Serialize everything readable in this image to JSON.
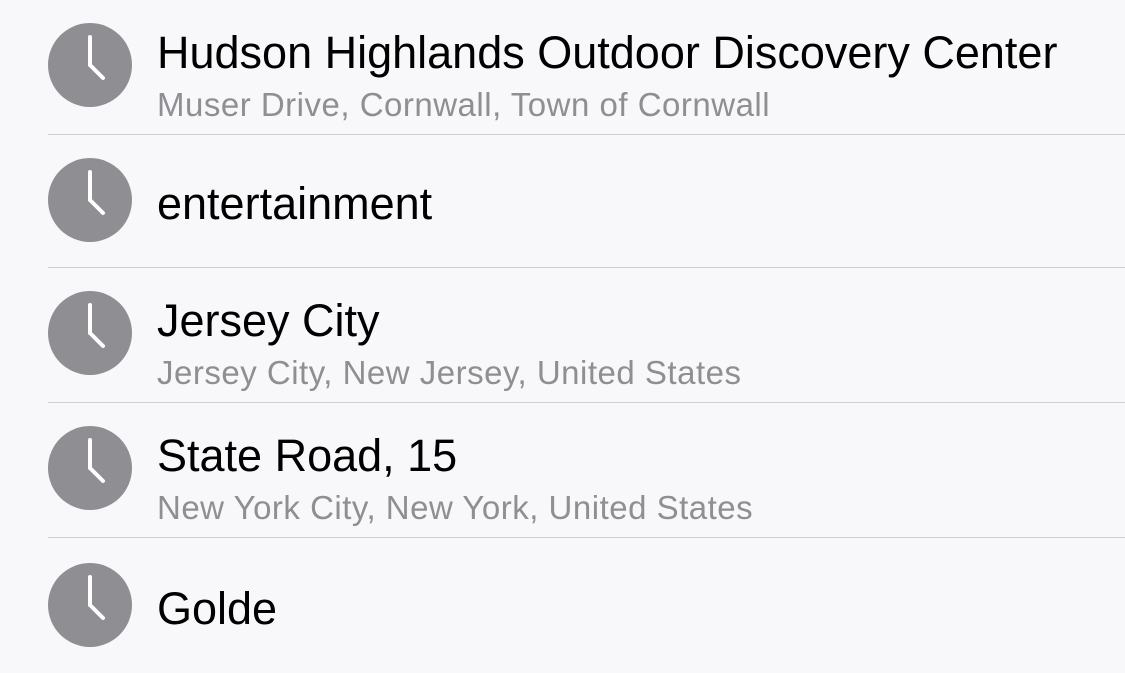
{
  "recents": {
    "items": [
      {
        "title": "Hudson Highlands Outdoor Discovery Center",
        "subtitle": "Muser Drive, Cornwall, Town of Cornwall",
        "icon": "clock-icon"
      },
      {
        "title": "entertainment",
        "subtitle": "",
        "icon": "clock-icon"
      },
      {
        "title": "Jersey City",
        "subtitle": "Jersey City, New Jersey, United States",
        "icon": "clock-icon"
      },
      {
        "title": "State Road, 15",
        "subtitle": "New York City, New York, United States",
        "icon": "clock-icon"
      },
      {
        "title": "Golde",
        "subtitle": "",
        "icon": "clock-icon"
      }
    ]
  },
  "colors": {
    "background": "#f8f8fa",
    "icon_fill": "#8e8e93",
    "separator": "#cfcfd3",
    "subtitle_text": "#8e8e93"
  }
}
